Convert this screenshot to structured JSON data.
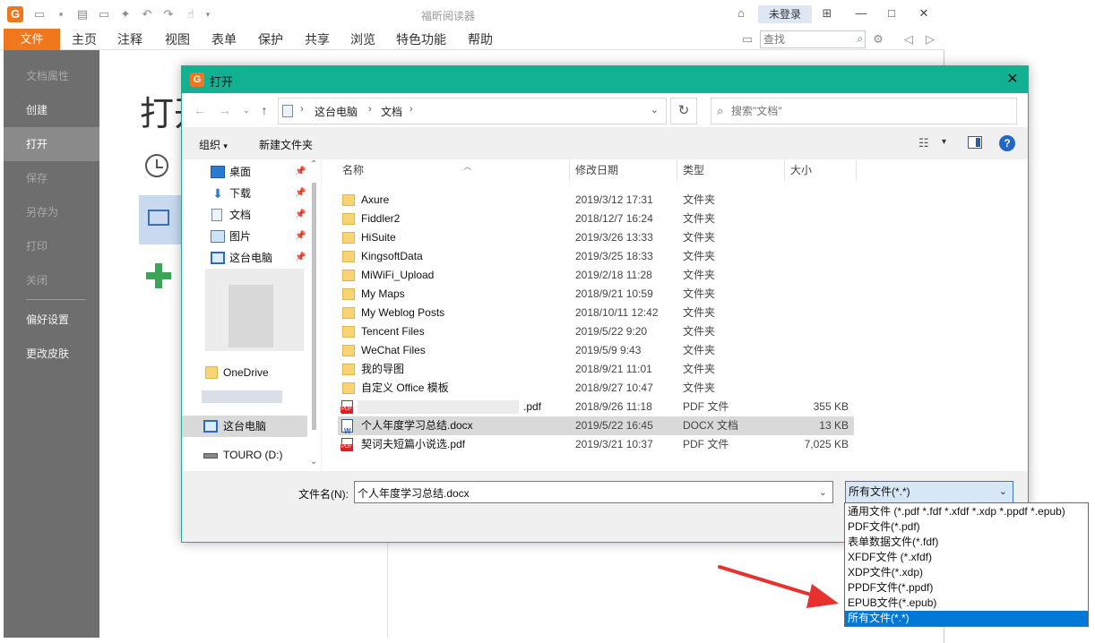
{
  "app": {
    "title": "福昕阅读器",
    "login": "未登录",
    "search_placeholder": "查找",
    "menu": [
      "文件",
      "主页",
      "注释",
      "视图",
      "表单",
      "保护",
      "共享",
      "浏览",
      "特色功能",
      "帮助"
    ],
    "sidebar": [
      "文档属性",
      "创建",
      "打开",
      "保存",
      "另存为",
      "打印",
      "关闭",
      "偏好设置",
      "更改皮肤"
    ],
    "main_title": "打开"
  },
  "dialog": {
    "title": "打开",
    "breadcrumb": [
      "这台电脑",
      "文档"
    ],
    "search_placeholder": "搜索\"文档\"",
    "toolbar": {
      "organize": "组织",
      "new_folder": "新建文件夹"
    },
    "nav": {
      "quick": [
        {
          "label": "桌面",
          "icon": "desktop-icon"
        },
        {
          "label": "下载",
          "icon": "download-icon"
        },
        {
          "label": "文档",
          "icon": "document-icon"
        },
        {
          "label": "图片",
          "icon": "picture-icon"
        },
        {
          "label": "这台电脑",
          "icon": "computer-icon"
        }
      ],
      "onedrive": "OneDrive",
      "thispc": "这台电脑",
      "drive": "TOURO (D:)"
    },
    "columns": [
      "名称",
      "修改日期",
      "类型",
      "大小"
    ],
    "files": [
      {
        "name": "Axure",
        "date": "2019/3/12 17:31",
        "type": "文件夹",
        "size": "",
        "kind": "folder"
      },
      {
        "name": "Fiddler2",
        "date": "2018/12/7 16:24",
        "type": "文件夹",
        "size": "",
        "kind": "folder"
      },
      {
        "name": "HiSuite",
        "date": "2019/3/26 13:33",
        "type": "文件夹",
        "size": "",
        "kind": "folder"
      },
      {
        "name": "KingsoftData",
        "date": "2019/3/25 18:33",
        "type": "文件夹",
        "size": "",
        "kind": "folder"
      },
      {
        "name": "MiWiFi_Upload",
        "date": "2019/2/18 11:28",
        "type": "文件夹",
        "size": "",
        "kind": "folder"
      },
      {
        "name": "My Maps",
        "date": "2018/9/21 10:59",
        "type": "文件夹",
        "size": "",
        "kind": "folder"
      },
      {
        "name": "My Weblog Posts",
        "date": "2018/10/11 12:42",
        "type": "文件夹",
        "size": "",
        "kind": "folder"
      },
      {
        "name": "Tencent Files",
        "date": "2019/5/22 9:20",
        "type": "文件夹",
        "size": "",
        "kind": "folder"
      },
      {
        "name": "WeChat Files",
        "date": "2019/5/9 9:43",
        "type": "文件夹",
        "size": "",
        "kind": "folder"
      },
      {
        "name": "我的导图",
        "date": "2018/9/21 11:01",
        "type": "文件夹",
        "size": "",
        "kind": "folder"
      },
      {
        "name": "自定义 Office 模板",
        "date": "2018/9/27 10:47",
        "type": "文件夹",
        "size": "",
        "kind": "folder"
      },
      {
        "name": ".pdf",
        "date": "2018/9/26 11:18",
        "type": "PDF 文件",
        "size": "355 KB",
        "kind": "pdf"
      },
      {
        "name": "个人年度学习总结.docx",
        "date": "2019/5/22 16:45",
        "type": "DOCX 文档",
        "size": "13 KB",
        "kind": "doc",
        "selected": true
      },
      {
        "name": "契诃夫短篇小说选.pdf",
        "date": "2019/3/21 10:37",
        "type": "PDF 文件",
        "size": "7,025 KB",
        "kind": "pdf"
      }
    ],
    "filename_label": "文件名(N):",
    "filename_value": "个人年度学习总结.docx",
    "filetype_value": "所有文件(*.*)",
    "filetype_options": [
      "通用文件 (*.pdf *.fdf *.xfdf *.xdp *.ppdf *.epub)",
      "PDF文件(*.pdf)",
      "表单数据文件(*.fdf)",
      "XFDF文件 (*.xfdf)",
      "XDP文件(*.xdp)",
      "PPDF文件(*.ppdf)",
      "EPUB文件(*.epub)",
      "所有文件(*.*)"
    ],
    "filetype_selected_index": 7
  },
  "colors": {
    "accent_orange": "#f0771c",
    "dialog_titlebar": "#12b194",
    "selection_blue": "#0078d7",
    "arrow_red": "#e8312f"
  }
}
